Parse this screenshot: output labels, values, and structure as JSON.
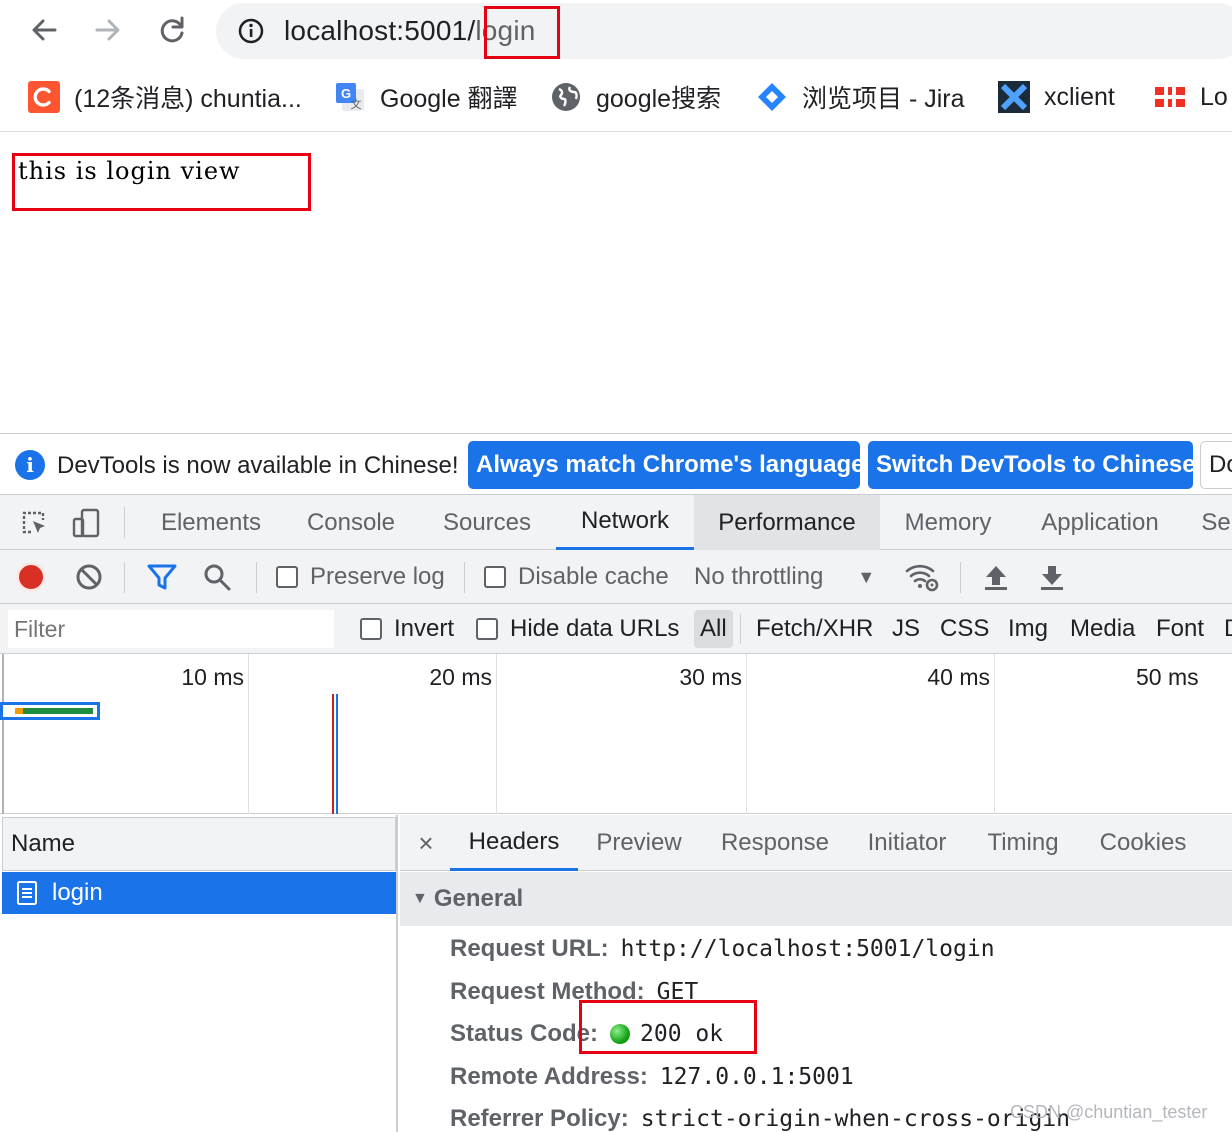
{
  "browser": {
    "url_host": "localhost:5001/",
    "url_path": "login",
    "bookmarks": [
      {
        "label": "(12条消息) chuntia...",
        "icon": "csdn-icon",
        "color": "#fc5531"
      },
      {
        "label": "Google 翻譯",
        "icon": "google-translate-icon",
        "color": "#4285f4"
      },
      {
        "label": "google搜索",
        "icon": "globe-icon",
        "color": "#5f6368"
      },
      {
        "label": "浏览项目 - Jira",
        "icon": "jira-icon",
        "color": "#2684ff"
      },
      {
        "label": "xclient",
        "icon": "xclient-icon",
        "color": "#1565c0"
      },
      {
        "label": "Lo",
        "icon": "fortinet-icon",
        "color": "#ee3124"
      }
    ]
  },
  "page": {
    "content_text": "this is login view"
  },
  "devtools": {
    "infobar": {
      "message": "DevTools is now available in Chinese!",
      "btn_match": "Always match Chrome's language",
      "btn_switch": "Switch DevTools to Chinese",
      "btn_dont": "Do"
    },
    "tabs": [
      "Elements",
      "Console",
      "Sources",
      "Network",
      "Performance",
      "Memory",
      "Application",
      "Se"
    ],
    "active_tab": "Network",
    "network_toolbar": {
      "preserve_log": "Preserve log",
      "disable_cache": "Disable cache",
      "throttling": "No throttling"
    },
    "filter": {
      "placeholder": "Filter",
      "invert": "Invert",
      "hide_data_urls": "Hide data URLs",
      "types": [
        "All",
        "Fetch/XHR",
        "JS",
        "CSS",
        "Img",
        "Media",
        "Font",
        "D"
      ],
      "active_type": "All"
    },
    "timeline": {
      "ticks": [
        "10 ms",
        "20 ms",
        "30 ms",
        "40 ms",
        "50 ms"
      ]
    },
    "requests": {
      "header": "Name",
      "rows": [
        {
          "name": "login"
        }
      ]
    },
    "detail": {
      "close": "×",
      "tabs": [
        "Headers",
        "Preview",
        "Response",
        "Initiator",
        "Timing",
        "Cookies"
      ],
      "active_tab": "Headers",
      "general_title": "General",
      "fields": [
        {
          "key": "Request URL:",
          "value": "http://localhost:5001/login"
        },
        {
          "key": "Request Method:",
          "value": "GET"
        },
        {
          "key": "Status Code:",
          "value": "200 ok"
        },
        {
          "key": "Remote Address:",
          "value": "127.0.0.1:5001"
        },
        {
          "key": "Referrer Policy:",
          "value": "strict-origin-when-cross-origin"
        }
      ]
    }
  },
  "watermark": "CSDN @chuntian_tester",
  "colors": {
    "accent": "#1a73e8",
    "highlight": "#e60012",
    "record": "#d93025"
  }
}
